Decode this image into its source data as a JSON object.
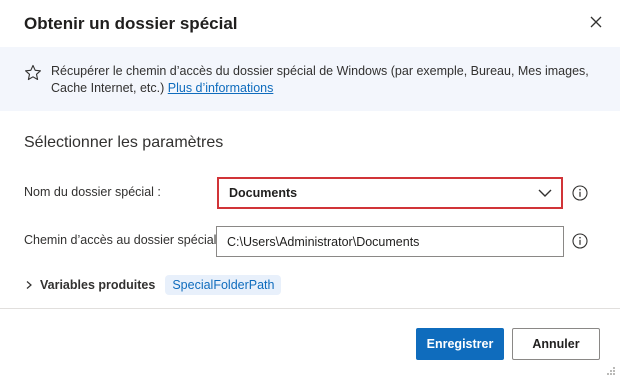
{
  "dialog": {
    "title": "Obtenir un dossier spécial",
    "close_icon": "close-icon",
    "description": "Récupérer le chemin d’accès du dossier spécial de Windows (par exemple, Bureau, Mes images, Cache Internet, etc.)",
    "more_info_link": "Plus d’informations",
    "section_title": "Sélectionner les paramètres"
  },
  "fields": {
    "special_folder_label": "Nom du dossier spécial :",
    "special_folder_value": "Documents",
    "path_label": "Chemin d’accès au dossier spécial :",
    "path_value": "C:\\Users\\Administrator\\Documents"
  },
  "variables": {
    "label": "Variables produites",
    "items": [
      "SpecialFolderPath"
    ]
  },
  "buttons": {
    "save": "Enregistrer",
    "cancel": "Annuler"
  },
  "colors": {
    "accent": "#0f6cbd",
    "error_border": "#d13438",
    "info_band": "#f3f6fc"
  }
}
